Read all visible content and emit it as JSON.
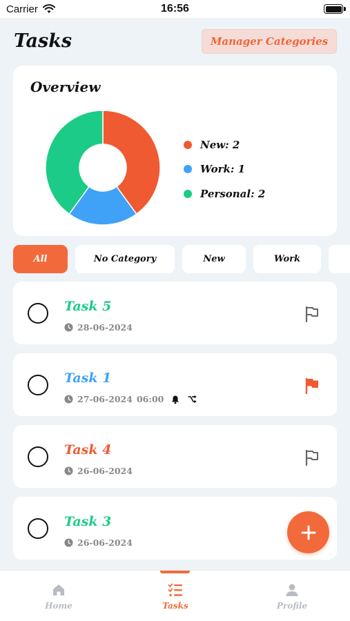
{
  "status_bar": {
    "carrier": "Carrier",
    "time": "16:56"
  },
  "header": {
    "title": "Tasks",
    "manager_button": "Manager Categories"
  },
  "overview": {
    "title": "Overview",
    "legend": [
      {
        "label": "New: 2",
        "color": "#f05a32"
      },
      {
        "label": "Work: 1",
        "color": "#3fa2f6"
      },
      {
        "label": "Personal: 2",
        "color": "#1ccb86"
      }
    ]
  },
  "chart_data": {
    "type": "pie",
    "categories": [
      "New",
      "Work",
      "Personal"
    ],
    "values": [
      2,
      1,
      2
    ],
    "colors": [
      "#f05a32",
      "#3fa2f6",
      "#1ccb86"
    ]
  },
  "filters": [
    {
      "label": "All",
      "active": true
    },
    {
      "label": "No Category",
      "active": false
    },
    {
      "label": "New",
      "active": false
    },
    {
      "label": "Work",
      "active": false
    }
  ],
  "tasks": [
    {
      "name": "Task 5",
      "color": "#1ccb86",
      "date": "28-06-2024",
      "time": "",
      "flagged": false
    },
    {
      "name": "Task 1",
      "color": "#3fa2f6",
      "date": "27-06-2024",
      "time": "06:00",
      "flagged": true
    },
    {
      "name": "Task 4",
      "color": "#f05a32",
      "date": "26-06-2024",
      "time": "",
      "flagged": false
    },
    {
      "name": "Task 3",
      "color": "#1ccb86",
      "date": "26-06-2024",
      "time": "",
      "flagged": false
    }
  ],
  "bottom_nav": {
    "items": [
      {
        "label": "Home",
        "icon": "home-icon",
        "active": false
      },
      {
        "label": "Tasks",
        "icon": "tasks-list-icon",
        "active": true
      },
      {
        "label": "Profile",
        "icon": "person-icon",
        "active": false
      }
    ]
  },
  "colors": {
    "accent": "#f26a3b",
    "background": "#eef3f8"
  }
}
